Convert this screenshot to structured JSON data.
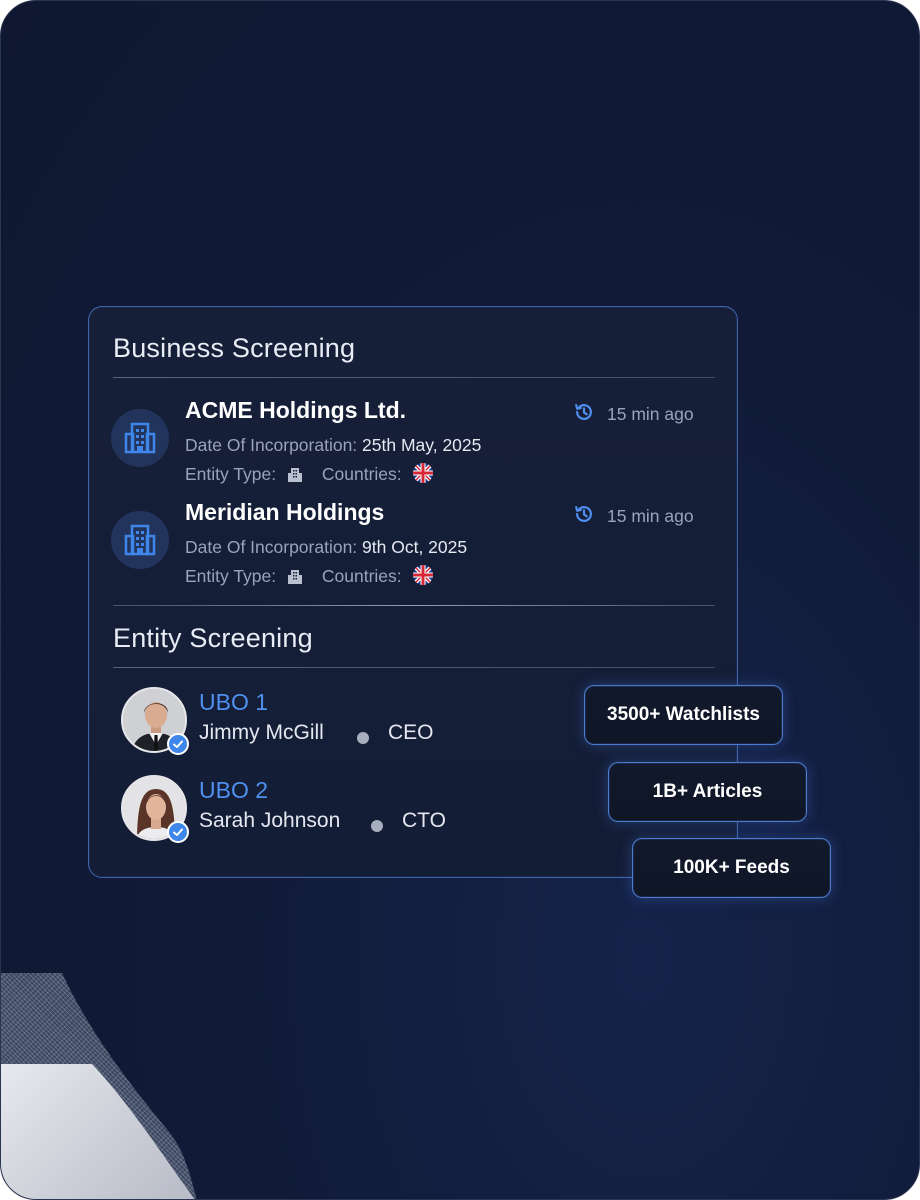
{
  "business_screening": {
    "title": "Business Screening",
    "items": [
      {
        "name": "ACME Holdings Ltd.",
        "incorporation_label": "Date Of Incorporation:",
        "incorporation_date": "25th May, 2025",
        "entity_type_label": "Entity Type:",
        "countries_label": "Countries:",
        "time": "15 min ago",
        "building_icon": "building-icon",
        "history_icon": "history-icon",
        "flag_icon": "uk-flag-icon"
      },
      {
        "name": "Meridian Holdings",
        "incorporation_label": "Date Of Incorporation:",
        "incorporation_date": "9th Oct, 2025",
        "entity_type_label": "Entity Type:",
        "countries_label": "Countries:",
        "time": "15 min ago",
        "building_icon": "building-icon",
        "history_icon": "history-icon",
        "flag_icon": "uk-flag-icon"
      }
    ]
  },
  "entity_screening": {
    "title": "Entity Screening",
    "ubos": [
      {
        "label": "UBO 1",
        "name": "Jimmy McGill",
        "role": "CEO",
        "avatar_icon": "avatar-male",
        "verified_icon": "verified-badge-icon"
      },
      {
        "label": "UBO 2",
        "name": "Sarah Johnson",
        "role": "CTO",
        "avatar_icon": "avatar-female",
        "verified_icon": "verified-badge-icon"
      }
    ]
  },
  "stats": [
    {
      "label": "3500+ Watchlists"
    },
    {
      "label": "1B+ Articles"
    },
    {
      "label": "100K+ Feeds"
    }
  ],
  "colors": {
    "background": "#111b38",
    "card_border": "#3f63a8",
    "accent_blue": "#4f8fee",
    "muted_text": "#9aa3b8"
  }
}
